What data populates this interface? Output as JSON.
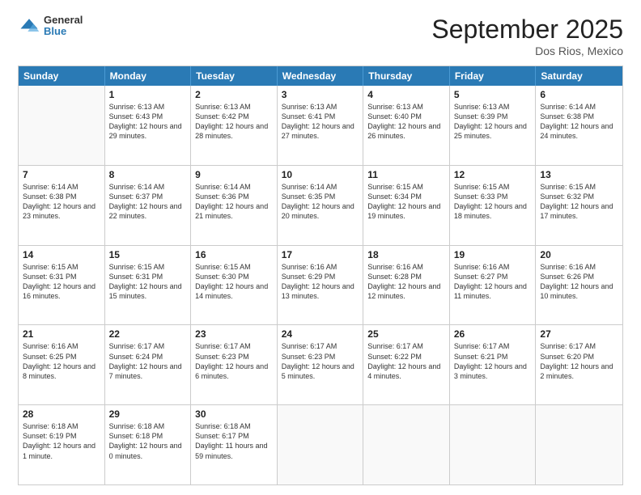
{
  "header": {
    "logo": {
      "general": "General",
      "blue": "Blue"
    },
    "title": "September 2025",
    "location": "Dos Rios, Mexico"
  },
  "weekdays": [
    "Sunday",
    "Monday",
    "Tuesday",
    "Wednesday",
    "Thursday",
    "Friday",
    "Saturday"
  ],
  "rows": [
    [
      {
        "day": "",
        "empty": true
      },
      {
        "day": "1",
        "sunrise": "Sunrise: 6:13 AM",
        "sunset": "Sunset: 6:43 PM",
        "daylight": "Daylight: 12 hours and 29 minutes."
      },
      {
        "day": "2",
        "sunrise": "Sunrise: 6:13 AM",
        "sunset": "Sunset: 6:42 PM",
        "daylight": "Daylight: 12 hours and 28 minutes."
      },
      {
        "day": "3",
        "sunrise": "Sunrise: 6:13 AM",
        "sunset": "Sunset: 6:41 PM",
        "daylight": "Daylight: 12 hours and 27 minutes."
      },
      {
        "day": "4",
        "sunrise": "Sunrise: 6:13 AM",
        "sunset": "Sunset: 6:40 PM",
        "daylight": "Daylight: 12 hours and 26 minutes."
      },
      {
        "day": "5",
        "sunrise": "Sunrise: 6:13 AM",
        "sunset": "Sunset: 6:39 PM",
        "daylight": "Daylight: 12 hours and 25 minutes."
      },
      {
        "day": "6",
        "sunrise": "Sunrise: 6:14 AM",
        "sunset": "Sunset: 6:38 PM",
        "daylight": "Daylight: 12 hours and 24 minutes."
      }
    ],
    [
      {
        "day": "7",
        "sunrise": "Sunrise: 6:14 AM",
        "sunset": "Sunset: 6:38 PM",
        "daylight": "Daylight: 12 hours and 23 minutes."
      },
      {
        "day": "8",
        "sunrise": "Sunrise: 6:14 AM",
        "sunset": "Sunset: 6:37 PM",
        "daylight": "Daylight: 12 hours and 22 minutes."
      },
      {
        "day": "9",
        "sunrise": "Sunrise: 6:14 AM",
        "sunset": "Sunset: 6:36 PM",
        "daylight": "Daylight: 12 hours and 21 minutes."
      },
      {
        "day": "10",
        "sunrise": "Sunrise: 6:14 AM",
        "sunset": "Sunset: 6:35 PM",
        "daylight": "Daylight: 12 hours and 20 minutes."
      },
      {
        "day": "11",
        "sunrise": "Sunrise: 6:15 AM",
        "sunset": "Sunset: 6:34 PM",
        "daylight": "Daylight: 12 hours and 19 minutes."
      },
      {
        "day": "12",
        "sunrise": "Sunrise: 6:15 AM",
        "sunset": "Sunset: 6:33 PM",
        "daylight": "Daylight: 12 hours and 18 minutes."
      },
      {
        "day": "13",
        "sunrise": "Sunrise: 6:15 AM",
        "sunset": "Sunset: 6:32 PM",
        "daylight": "Daylight: 12 hours and 17 minutes."
      }
    ],
    [
      {
        "day": "14",
        "sunrise": "Sunrise: 6:15 AM",
        "sunset": "Sunset: 6:31 PM",
        "daylight": "Daylight: 12 hours and 16 minutes."
      },
      {
        "day": "15",
        "sunrise": "Sunrise: 6:15 AM",
        "sunset": "Sunset: 6:31 PM",
        "daylight": "Daylight: 12 hours and 15 minutes."
      },
      {
        "day": "16",
        "sunrise": "Sunrise: 6:15 AM",
        "sunset": "Sunset: 6:30 PM",
        "daylight": "Daylight: 12 hours and 14 minutes."
      },
      {
        "day": "17",
        "sunrise": "Sunrise: 6:16 AM",
        "sunset": "Sunset: 6:29 PM",
        "daylight": "Daylight: 12 hours and 13 minutes."
      },
      {
        "day": "18",
        "sunrise": "Sunrise: 6:16 AM",
        "sunset": "Sunset: 6:28 PM",
        "daylight": "Daylight: 12 hours and 12 minutes."
      },
      {
        "day": "19",
        "sunrise": "Sunrise: 6:16 AM",
        "sunset": "Sunset: 6:27 PM",
        "daylight": "Daylight: 12 hours and 11 minutes."
      },
      {
        "day": "20",
        "sunrise": "Sunrise: 6:16 AM",
        "sunset": "Sunset: 6:26 PM",
        "daylight": "Daylight: 12 hours and 10 minutes."
      }
    ],
    [
      {
        "day": "21",
        "sunrise": "Sunrise: 6:16 AM",
        "sunset": "Sunset: 6:25 PM",
        "daylight": "Daylight: 12 hours and 8 minutes."
      },
      {
        "day": "22",
        "sunrise": "Sunrise: 6:17 AM",
        "sunset": "Sunset: 6:24 PM",
        "daylight": "Daylight: 12 hours and 7 minutes."
      },
      {
        "day": "23",
        "sunrise": "Sunrise: 6:17 AM",
        "sunset": "Sunset: 6:23 PM",
        "daylight": "Daylight: 12 hours and 6 minutes."
      },
      {
        "day": "24",
        "sunrise": "Sunrise: 6:17 AM",
        "sunset": "Sunset: 6:23 PM",
        "daylight": "Daylight: 12 hours and 5 minutes."
      },
      {
        "day": "25",
        "sunrise": "Sunrise: 6:17 AM",
        "sunset": "Sunset: 6:22 PM",
        "daylight": "Daylight: 12 hours and 4 minutes."
      },
      {
        "day": "26",
        "sunrise": "Sunrise: 6:17 AM",
        "sunset": "Sunset: 6:21 PM",
        "daylight": "Daylight: 12 hours and 3 minutes."
      },
      {
        "day": "27",
        "sunrise": "Sunrise: 6:17 AM",
        "sunset": "Sunset: 6:20 PM",
        "daylight": "Daylight: 12 hours and 2 minutes."
      }
    ],
    [
      {
        "day": "28",
        "sunrise": "Sunrise: 6:18 AM",
        "sunset": "Sunset: 6:19 PM",
        "daylight": "Daylight: 12 hours and 1 minute."
      },
      {
        "day": "29",
        "sunrise": "Sunrise: 6:18 AM",
        "sunset": "Sunset: 6:18 PM",
        "daylight": "Daylight: 12 hours and 0 minutes."
      },
      {
        "day": "30",
        "sunrise": "Sunrise: 6:18 AM",
        "sunset": "Sunset: 6:17 PM",
        "daylight": "Daylight: 11 hours and 59 minutes."
      },
      {
        "day": "",
        "empty": true
      },
      {
        "day": "",
        "empty": true
      },
      {
        "day": "",
        "empty": true
      },
      {
        "day": "",
        "empty": true
      }
    ]
  ]
}
